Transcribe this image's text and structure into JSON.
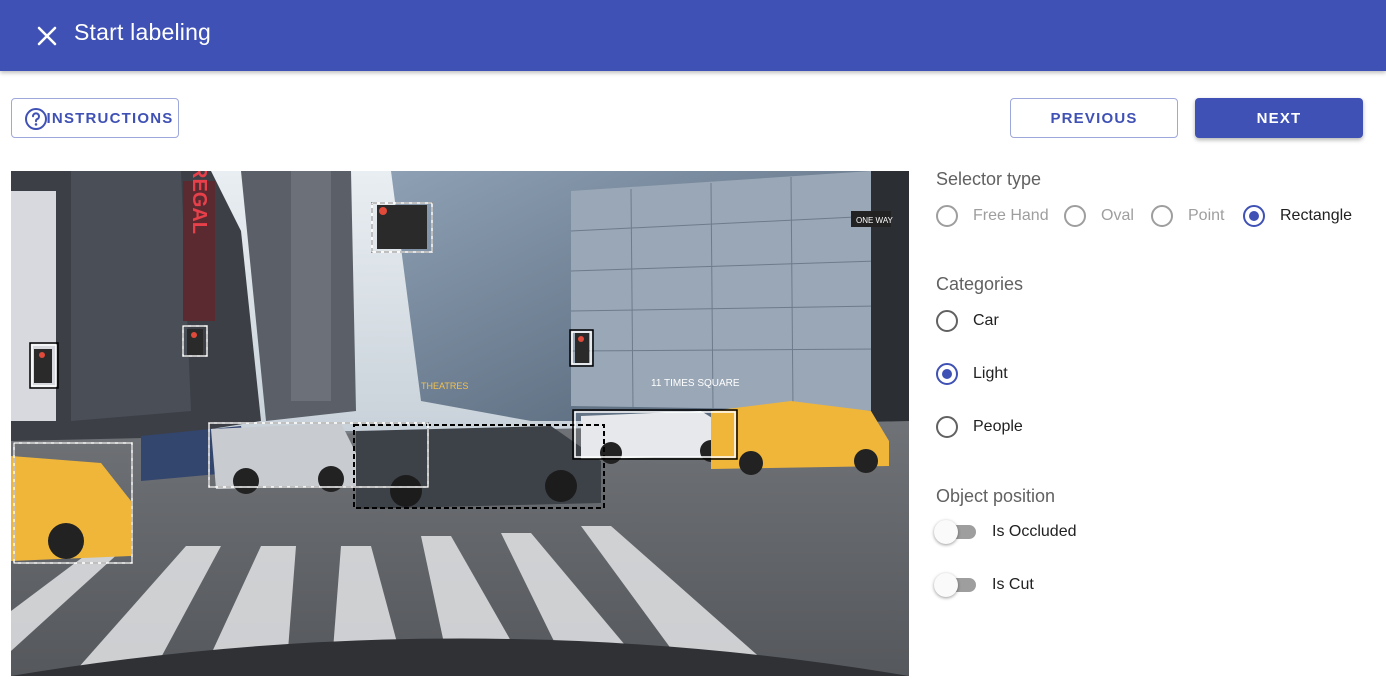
{
  "appbar": {
    "title": "Start labeling"
  },
  "toolbar": {
    "instructions_label": "INSTRUCTIONS",
    "previous_label": "PREVIOUS",
    "next_label": "NEXT"
  },
  "colors": {
    "primary": "#3f51b5",
    "inactive": "#9e9e9e"
  },
  "scene": {
    "sign_regal": "REGAL",
    "sign_theatres": "THEATRES",
    "sign_times_square": "11 TIMES SQUARE",
    "sign_one_way": "ONE WAY"
  },
  "selector_type": {
    "title": "Selector type",
    "options": [
      {
        "label": "Free Hand",
        "selected": false
      },
      {
        "label": "Oval",
        "selected": false
      },
      {
        "label": "Point",
        "selected": false
      },
      {
        "label": "Rectangle",
        "selected": true
      }
    ]
  },
  "categories": {
    "title": "Categories",
    "options": [
      {
        "label": "Car",
        "selected": false
      },
      {
        "label": "Light",
        "selected": true
      },
      {
        "label": "People",
        "selected": false
      }
    ]
  },
  "object_position": {
    "title": "Object position",
    "toggles": [
      {
        "label": "Is Occluded",
        "on": false
      },
      {
        "label": "Is Cut",
        "on": false
      }
    ]
  }
}
